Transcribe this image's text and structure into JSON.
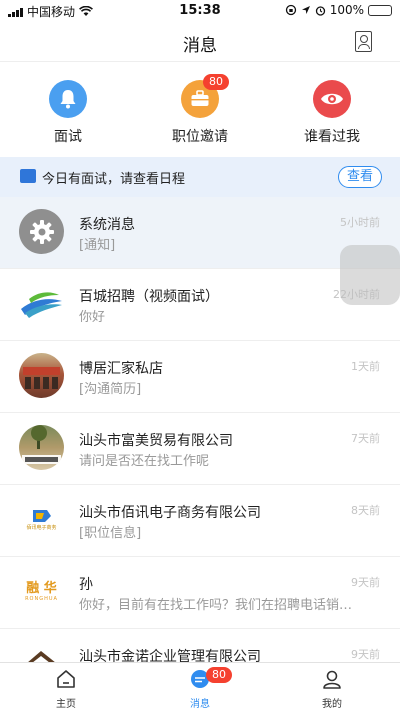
{
  "status_bar": {
    "carrier": "中国移动",
    "time": "15:38",
    "battery": "100%"
  },
  "header": {
    "title": "消息",
    "contacts_icon": "contacts-icon"
  },
  "quick_actions": [
    {
      "label": "面试",
      "icon": "bell-icon",
      "color": "#4a9ff0"
    },
    {
      "label": "职位邀请",
      "icon": "briefcase-icon",
      "color": "#f4a23b",
      "badge": "80"
    },
    {
      "label": "谁看过我",
      "icon": "eye-icon",
      "color": "#ea4a4c"
    }
  ],
  "banner": {
    "text": "今日有面试，请查看日程",
    "button": "查看"
  },
  "messages": [
    {
      "title": "系统消息",
      "subtitle": "[通知]",
      "time": "5小时前"
    },
    {
      "title": "百城招聘（视频面试）",
      "subtitle": "你好",
      "time": "22小时前"
    },
    {
      "title": "博居汇家私店",
      "subtitle": "[沟通简历]",
      "time": "1天前"
    },
    {
      "title": "汕头市富美贸易有限公司",
      "subtitle": "请问是否还在找工作呢",
      "time": "7天前"
    },
    {
      "title": "汕头市佰讯电子商务有限公司",
      "subtitle": "[职位信息]",
      "time": "8天前"
    },
    {
      "title": "孙",
      "subtitle": "你好，目前有在找工作吗？我们在招聘电话销…",
      "time": "9天前"
    },
    {
      "title": "汕头市金诺企业管理有限公司",
      "subtitle": "",
      "time": "9天前"
    }
  ],
  "avatar_logos": {
    "rong_hua": "融 华",
    "rong_hua_en": "RONGHUA",
    "baixun": "佰讯电子商务"
  },
  "tabs": [
    {
      "label": "主页",
      "icon": "home-icon"
    },
    {
      "label": "消息",
      "icon": "chat-icon",
      "badge": "80"
    },
    {
      "label": "我的",
      "icon": "user-icon"
    }
  ],
  "colors": {
    "accent": "#2f8cef",
    "badge": "#f5412f"
  }
}
